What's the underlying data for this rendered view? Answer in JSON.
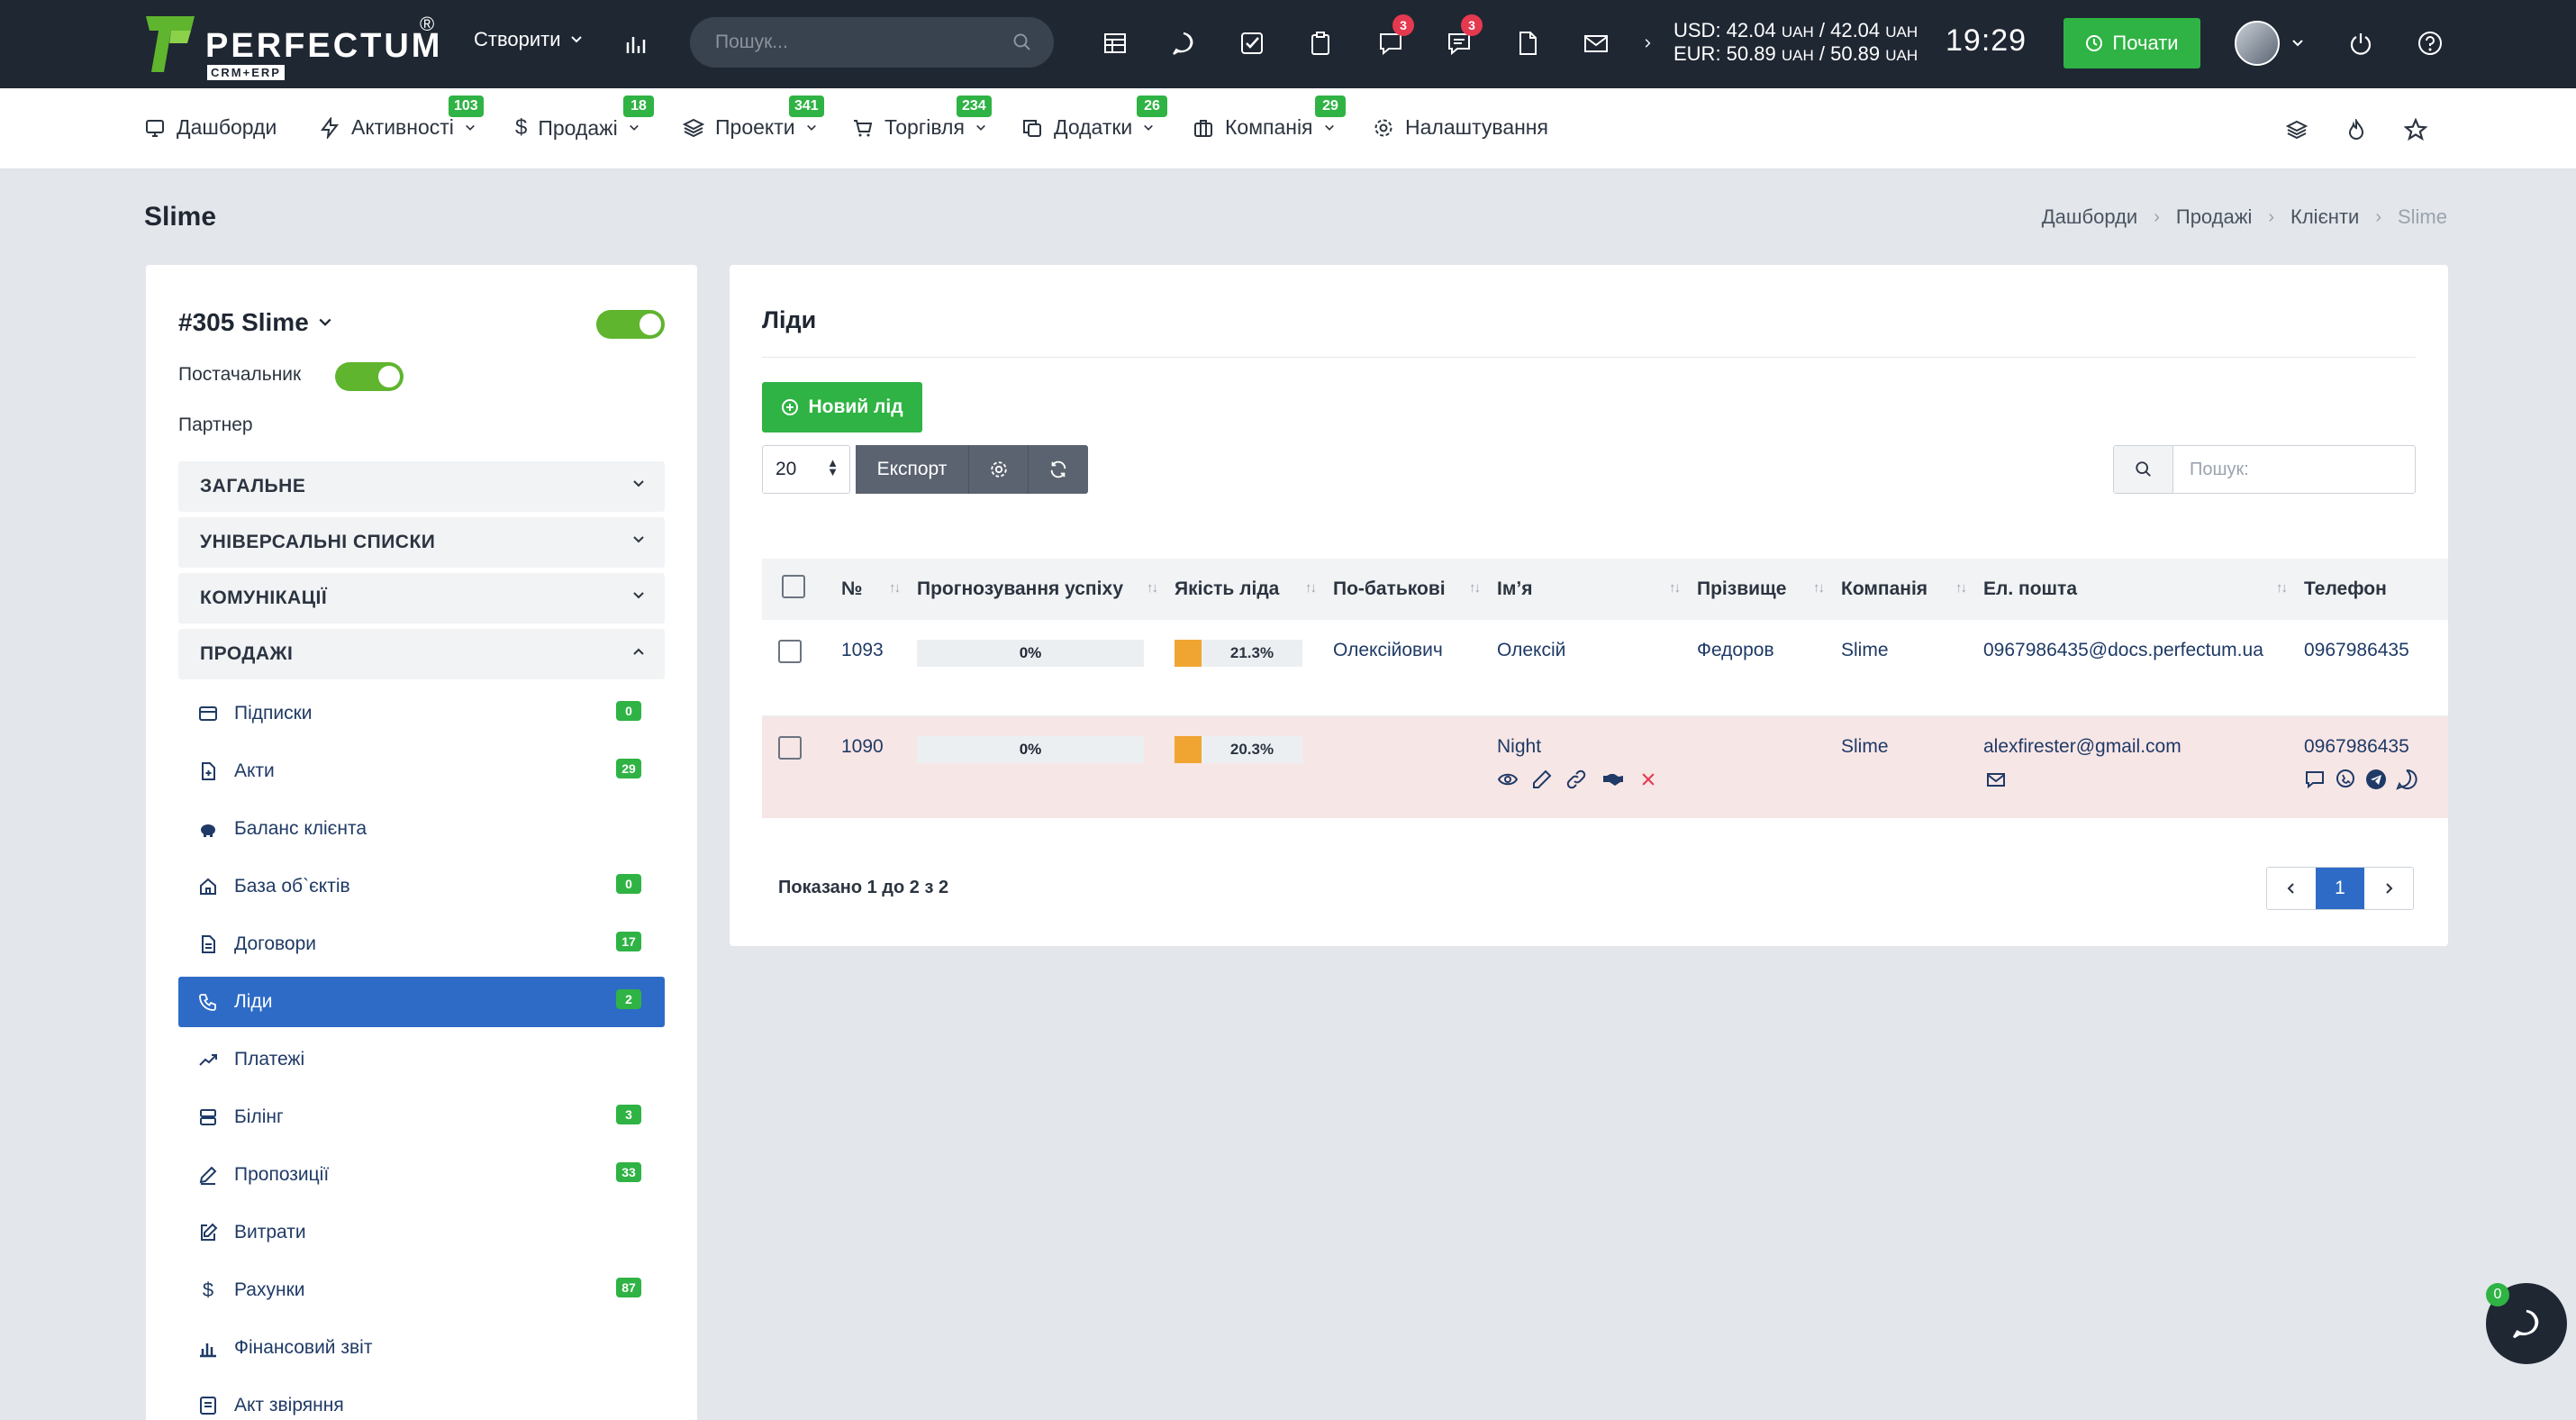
{
  "logo": {
    "name": "PERFECTUM",
    "sub": "CRM+ERP",
    "reg": "®"
  },
  "top": {
    "create_label": "Створити",
    "search_placeholder": "Пошук...",
    "notif_badge_1": "3",
    "notif_badge_2": "3",
    "usd_line": "USD: 42.04",
    "usd_unit1": "UAH",
    "usd_sep": " / 42.04",
    "usd_unit2": "UAH",
    "eur_line": "EUR: 50.89",
    "eur_unit1": "UAH",
    "eur_sep": " / 50.89",
    "eur_unit2": "UAH",
    "time": "19:29",
    "start_label": "Почати"
  },
  "nav": {
    "items": [
      {
        "label": "Дашборди",
        "badge": ""
      },
      {
        "label": "Активності",
        "badge": "103"
      },
      {
        "label": "Продажі",
        "badge": "18"
      },
      {
        "label": "Проекти",
        "badge": "341"
      },
      {
        "label": "Торгівля",
        "badge": "234"
      },
      {
        "label": "Додатки",
        "badge": "26"
      },
      {
        "label": "Компанія",
        "badge": "29"
      },
      {
        "label": "Налаштування",
        "badge": ""
      }
    ]
  },
  "page": {
    "title": "Slime",
    "breadcrumb": [
      "Дашборди",
      "Продажі",
      "Клієнти",
      "Slime"
    ]
  },
  "client": {
    "title": "#305 Slime",
    "supplier_label": "Постачальник",
    "partner_label": "Партнер",
    "sections": [
      "ЗАГАЛЬНЕ",
      "УНІВЕРСАЛЬНІ СПИСКИ",
      "КОМУНІКАЦІЇ",
      "ПРОДАЖІ"
    ],
    "sales_items": [
      {
        "label": "Підписки",
        "badge": "0"
      },
      {
        "label": "Акти",
        "badge": "29"
      },
      {
        "label": "Баланс клієнта",
        "badge": ""
      },
      {
        "label": "База об`єктів",
        "badge": "0"
      },
      {
        "label": "Договори",
        "badge": "17"
      },
      {
        "label": "Ліди",
        "badge": "2"
      },
      {
        "label": "Платежі",
        "badge": ""
      },
      {
        "label": "Білінг",
        "badge": "3"
      },
      {
        "label": "Пропозиції",
        "badge": "33"
      },
      {
        "label": "Витрати",
        "badge": ""
      },
      {
        "label": "Рахунки",
        "badge": "87"
      },
      {
        "label": "Фінансовий звіт",
        "badge": ""
      },
      {
        "label": "Акт звіряння",
        "badge": ""
      }
    ]
  },
  "leads": {
    "title": "Ліди",
    "new_button": "Новий лід",
    "page_size": "20",
    "export_label": "Експорт",
    "search_placeholder": "Пошук:",
    "columns": [
      "№",
      "Прогнозування успіху",
      "Якість ліда",
      "По-батькові",
      "Імʼя",
      "Прізвище",
      "Компанія",
      "Ел. пошта",
      "Телефон"
    ],
    "rows": [
      {
        "id": "1093",
        "forecast": "0%",
        "quality": "21.3%",
        "patronymic": "Олексійович",
        "first_name": "Олексій",
        "last_name": "Федоров",
        "company": "Slime",
        "email": "0967986435@docs.perfectum.ua",
        "phone": "0967986435"
      },
      {
        "id": "1090",
        "forecast": "0%",
        "quality": "20.3%",
        "patronymic": "",
        "first_name": "Night",
        "last_name": "",
        "company": "Slime",
        "email": "alexfirester@gmail.com",
        "phone": "0967986435"
      }
    ],
    "shown_text": "Показано 1 до 2 з 2",
    "current_page": "1"
  },
  "chat": {
    "badge": "0"
  }
}
